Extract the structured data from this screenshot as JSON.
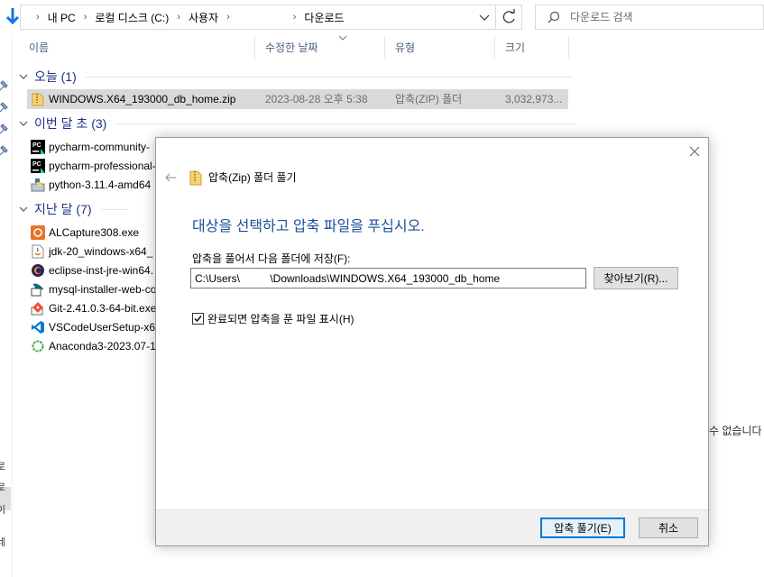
{
  "address_bar": {
    "crumbs": [
      "내 PC",
      "로컬 디스크 (C:)",
      "사용자",
      "",
      "다운로드"
    ],
    "separator": "›"
  },
  "search": {
    "placeholder": "다운로드 검색"
  },
  "columns": {
    "name": "이름",
    "date": "수정한 날짜",
    "type": "유형",
    "size": "크기"
  },
  "groups": {
    "today": {
      "title": "오늘 (1)"
    },
    "this_month": {
      "title": "이번 달 초 (3)"
    },
    "last_month": {
      "title": "지난 달 (7)"
    }
  },
  "files_today": [
    {
      "name": "WINDOWS.X64_193000_db_home.zip",
      "date": "2023-08-28 오후 5:38",
      "type": "압축(ZIP) 폴더",
      "size": "3,032,973..."
    }
  ],
  "files_this_month": [
    {
      "name": "pycharm-community-"
    },
    {
      "name": "pycharm-professional-"
    },
    {
      "name": "python-3.11.4-amd64"
    }
  ],
  "files_last_month": [
    {
      "name": "ALCapture308.exe"
    },
    {
      "name": "jdk-20_windows-x64_"
    },
    {
      "name": "eclipse-inst-jre-win64."
    },
    {
      "name": "mysql-installer-web-co"
    },
    {
      "name": "Git-2.41.0.3-64-bit.exe"
    },
    {
      "name": "VSCodeUserSetup-x64"
    },
    {
      "name": "Anaconda3-2023.07-1"
    }
  ],
  "right_message": "수 없습니다",
  "nav_fragments": [
    "로",
    "로",
    "이",
    "네"
  ],
  "dialog": {
    "title": "압축(Zip) 폴더 풀기",
    "instruction": "대상을 선택하고 압축 파일을 푸십시오.",
    "path_label": "압축을 풀어서 다음 폴더에 저장(F):",
    "path_value": "C:\\Users\\          \\Downloads\\WINDOWS.X64_193000_db_home",
    "browse_label": "찾아보기(R)...",
    "show_files_label": "완료되면 압축을 푼 파일 표시(H)",
    "show_files_checked": true,
    "extract_label": "압축 풀기(E)",
    "cancel_label": "취소"
  },
  "colors": {
    "group_title": "#1e3287",
    "instruction": "#1b4f9a",
    "header_text": "#4c607a",
    "accent": "#0078d7"
  }
}
